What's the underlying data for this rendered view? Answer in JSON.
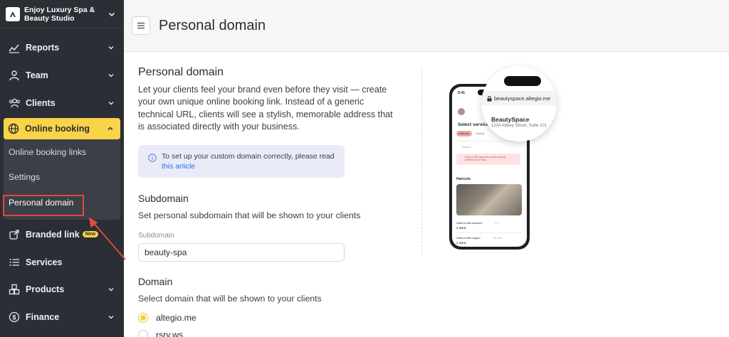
{
  "brand": {
    "name": "Enjoy Luxury Spa & Beauty Studio"
  },
  "nav": {
    "reports": "Reports",
    "team": "Team",
    "clients": "Clients",
    "online_booking": "Online booking",
    "sub_items": [
      "Online booking links",
      "Settings",
      "Personal domain"
    ],
    "branded_link": "Branded link",
    "new_badge": "New",
    "services": "Services",
    "products": "Products",
    "finance": "Finance"
  },
  "header": {
    "title": "Personal domain"
  },
  "main": {
    "title": "Personal domain",
    "description": "Let your clients feel your brand even before they visit — create your own unique online booking link. Instead of a generic technical URL, clients will see a stylish, memorable address that is associated directly with your business.",
    "info_text": "To set up your custom domain correctly, please read",
    "info_link": "this article",
    "subdomain_title": "Subdomain",
    "subdomain_desc": "Set personal subdomain that will be shown to your clients",
    "subdomain_label": "Subdomain",
    "subdomain_value": "beauty-spa",
    "domain_title": "Domain",
    "domain_desc": "Select domain that will be shown to your clients",
    "domain_options": [
      "altegio.me",
      "rsrv.ws"
    ],
    "domain_selected": "altegio.me"
  },
  "illustration": {
    "url": "beautyspace.altegio.me",
    "business_name": "BeautySpace",
    "address": "1234 Abbey Street, Suite 101",
    "phone_time": "9:41",
    "phone_heading": "Select services",
    "phone_tabs": [
      "Haircuts",
      "Styling"
    ],
    "phone_search": "Search",
    "phone_promo": "Enjoy a 15% discount on hair coloring until the end of May",
    "phone_section": "Haircuts",
    "phone_items": [
      {
        "name": "Haircut with scissors",
        "meta": "1 h",
        "price": "2 700 $"
      },
      {
        "name": "Haircut with clipper",
        "meta": "40 min",
        "price": "1 700 $"
      }
    ]
  },
  "colors": {
    "sidebar": "#2b2e35",
    "accent": "#f9d348",
    "highlight": "#e04a3b",
    "link": "#2f6ee0"
  }
}
